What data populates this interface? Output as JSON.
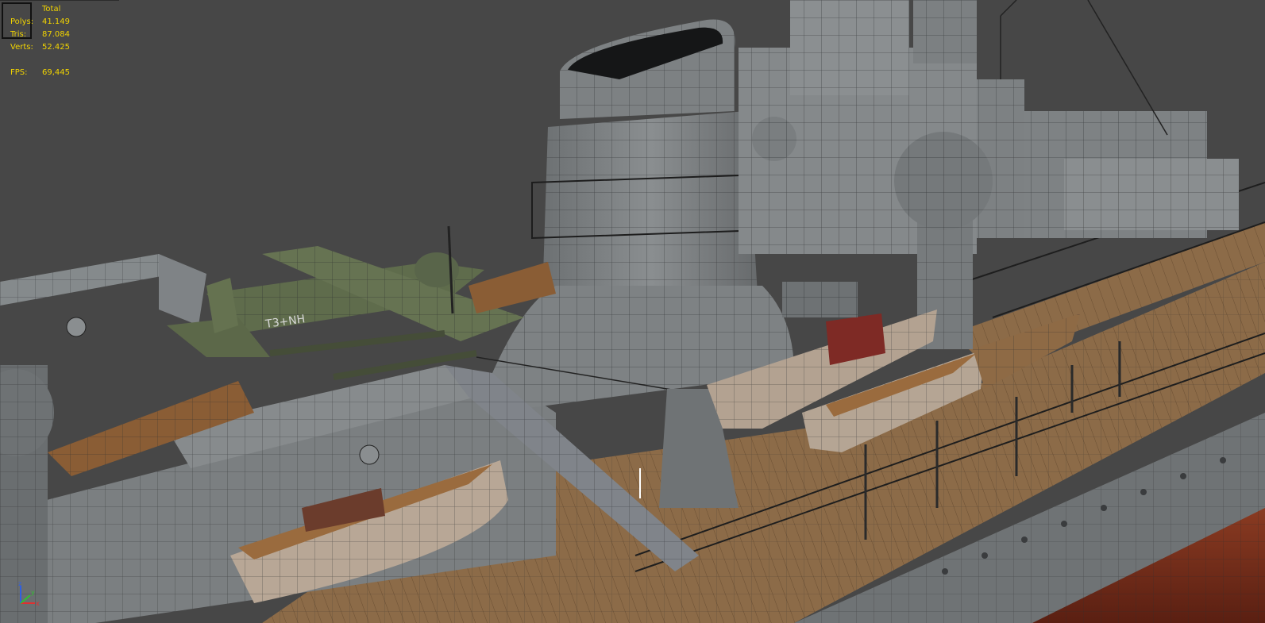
{
  "stats": {
    "title": "Total",
    "polys_label": "Polys:",
    "polys_value": "41.149",
    "tris_label": "Tris:",
    "tris_value": "87.084",
    "verts_label": "Verts:",
    "verts_value": "52.425",
    "fps_label": "FPS:",
    "fps_value": "69,445"
  },
  "plane_marking": "T3+NH",
  "axes": {
    "x": "x",
    "y": "y",
    "z": "z"
  },
  "colors": {
    "background": "#474747",
    "stats_text": "#f2d400",
    "hull": "#7a7e80",
    "deck": "#8a6a47",
    "hull_red": "#7a2e1c",
    "plane": "#5e6b4c"
  }
}
